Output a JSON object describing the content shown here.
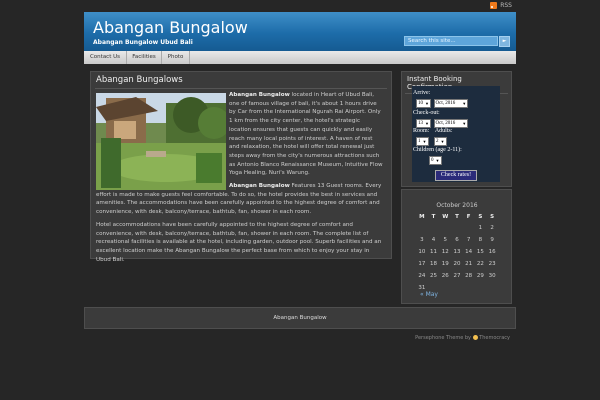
{
  "topbar": {
    "rss_label": "RSS"
  },
  "header": {
    "title": "Abangan Bungalow",
    "description": "Abangan Bungalow Ubud Bali",
    "search_placeholder": "Search this site...",
    "search_button": "►"
  },
  "nav": {
    "items": [
      {
        "label": "Contact Us"
      },
      {
        "label": "Facilities"
      },
      {
        "label": "Photo"
      }
    ]
  },
  "post": {
    "title": "Abangan Bungalows",
    "p1_strong": "Abangan Bungalow",
    "p1_text": " located in Heart of Ubud Bali, one of famous village of bali, it's about 1 hours drive by Car from the International Ngurah Rai Airport. Only 1 km from the city center, the hotel's strategic location ensures that guests can quickly and easily reach many local points of interest. A haven of rest and relaxation, the hotel will offer total renewal just steps away from the city's numerous attractions such as Antonio Blanco Renaissance Museum, Intuitive Flow Yoga Healing, Nuri's Warung.",
    "p2_strong": "Abangan Bungalow",
    "p2_text": " Features 13 Guest rooms. Every effort is made to make guests feel comfortable. To do so, the hotel provides the best in services and amenities. The accommodations have been carefully appointed to the highest degree of comfort and convenience, with desk, balcony/terrace, bathtub, fan, shower in each room.",
    "p3_text": "Hotel accommodations have been carefully appointed to the highest degree of comfort and convenience, with desk, balcony/terrace, bathtub, fan, shower in each room. The complete list of recreational facilities is available at the hotel, including garden, outdoor pool. Superb facilities and an excellent location make the Abangan Bungalow the perfect base from which to enjoy your stay in Ubud Bali."
  },
  "booking": {
    "title": "Instant Booking Confirmation",
    "arrive_label": "Arrive:",
    "arrive_day": "10",
    "arrive_month": "Oct, 2016",
    "checkout_label": "Check-out:",
    "checkout_day": "13",
    "checkout_month": "Oct, 2016",
    "room_label": "Room:",
    "adults_label": "Adults:",
    "room_value": "1",
    "adults_value": "2",
    "children_label": "Children (age 2-11):",
    "children_value": "0",
    "check_button": "Check rates!"
  },
  "calendar": {
    "caption": "October 2016",
    "days": [
      "M",
      "T",
      "W",
      "T",
      "F",
      "S",
      "S"
    ],
    "weeks": [
      [
        "",
        "",
        "",
        "",
        "",
        "1",
        "2"
      ],
      [
        "3",
        "4",
        "5",
        "6",
        "7",
        "8",
        "9"
      ],
      [
        "10",
        "11",
        "12",
        "13",
        "14",
        "15",
        "16"
      ],
      [
        "17",
        "18",
        "19",
        "20",
        "21",
        "22",
        "23"
      ],
      [
        "24",
        "25",
        "26",
        "27",
        "28",
        "29",
        "30"
      ],
      [
        "31",
        "",
        "",
        "",
        "",
        "",
        ""
      ]
    ],
    "prev_link": "« May"
  },
  "footer": {
    "text": "Abangan Bungalow"
  },
  "credit": {
    "theme": "Persephone Theme by",
    "author": "Themocracy"
  },
  "colors": {
    "header_blue": "#1d6ca9",
    "background": "#262626",
    "panel": "#3b3b3b",
    "link": "#7fb3e0"
  }
}
